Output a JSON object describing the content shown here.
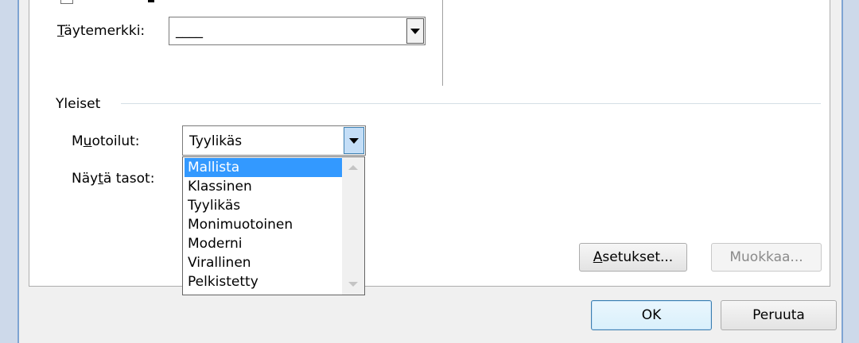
{
  "dialog": {
    "tab_leader": {
      "label_pre": "",
      "label_ul": "T",
      "label_post": "äytemerkki:",
      "value": "____"
    },
    "general_section": {
      "title": "Yleiset"
    },
    "formats": {
      "label_pre": "M",
      "label_ul": "u",
      "label_post": "otoilut:",
      "value": "Tyylikäs"
    },
    "show_levels": {
      "label_pre": "Näy",
      "label_ul": "t",
      "label_post": "ä tasot:"
    },
    "dropdown_options": [
      "Mallista",
      "Klassinen",
      "Tyylikäs",
      "Monimuotoinen",
      "Moderni",
      "Virallinen",
      "Pelkistetty"
    ],
    "selected_option": "Mallista",
    "buttons": {
      "options_ul": "A",
      "options_rest": "setukset...",
      "modify": "Muokkaa...",
      "ok": "OK",
      "cancel": "Peruuta"
    }
  }
}
